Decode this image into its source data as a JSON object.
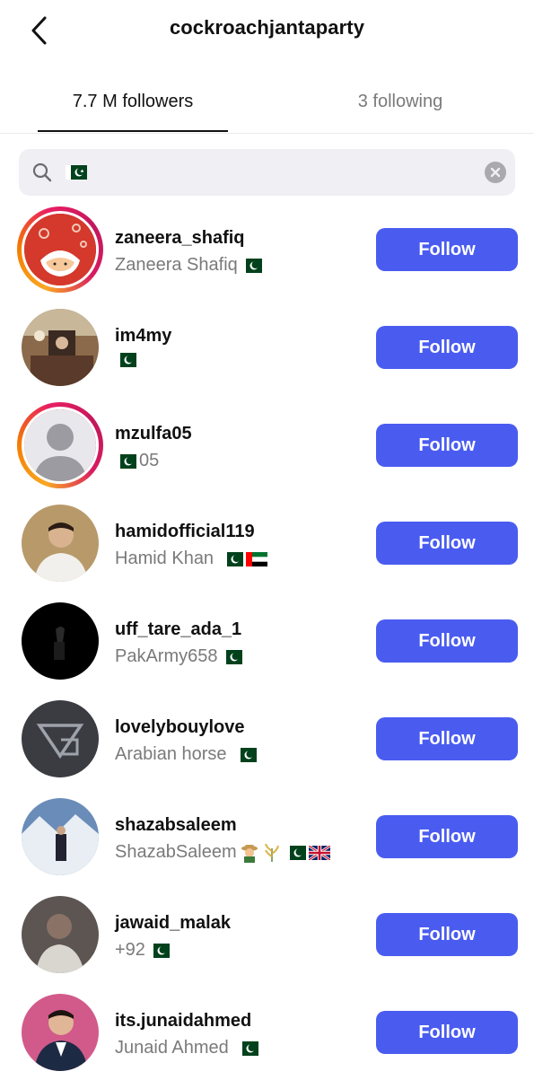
{
  "header": {
    "title": "cockroachjantaparty"
  },
  "tabs": {
    "followers": "7.7 M followers",
    "following": "3 following"
  },
  "search": {
    "value_icon": "pakistan-flag"
  },
  "colors": {
    "follow_button": "#4a5cf0",
    "story_ring": "#e91e63"
  },
  "rows": [
    {
      "username": "zaneera_shafiq",
      "sub_text": "Zaneera Shafiq",
      "flags": [
        "pakistan-flag"
      ],
      "follow_label": "Follow",
      "ring": true
    },
    {
      "username": "im4my",
      "sub_text": "",
      "flags": [
        "pakistan-flag"
      ],
      "follow_label": "Follow",
      "ring": false
    },
    {
      "username": "mzulfa05",
      "sub_text": "05",
      "flags_before": [
        "pakistan-flag"
      ],
      "follow_label": "Follow",
      "ring": true
    },
    {
      "username": "hamidofficial119",
      "sub_text": "Hamid Khan",
      "flags": [
        "pakistan-flag",
        "uae-flag"
      ],
      "follow_label": "Follow",
      "ring": false
    },
    {
      "username": "uff_tare_ada_1",
      "sub_text": "PakArmy658",
      "flags": [
        "pakistan-flag"
      ],
      "follow_label": "Follow",
      "ring": false
    },
    {
      "username": "lovelybouylove",
      "sub_text": "Arabian horse",
      "flags": [
        "pakistan-flag"
      ],
      "follow_label": "Follow",
      "ring": false
    },
    {
      "username": "shazabsaleem",
      "sub_text": "ShazabSaleem",
      "flags": [
        "farmer-emoji",
        "rice-emoji",
        "pakistan-flag",
        "uk-flag"
      ],
      "follow_label": "Follow",
      "ring": false
    },
    {
      "username": "jawaid_malak",
      "sub_text": "+92",
      "flags": [
        "pakistan-flag"
      ],
      "follow_label": "Follow",
      "ring": false
    },
    {
      "username": "its.junaidahmed",
      "sub_text": "Junaid Ahmed",
      "flags": [
        "pakistan-flag"
      ],
      "follow_label": "Follow",
      "ring": false
    }
  ]
}
